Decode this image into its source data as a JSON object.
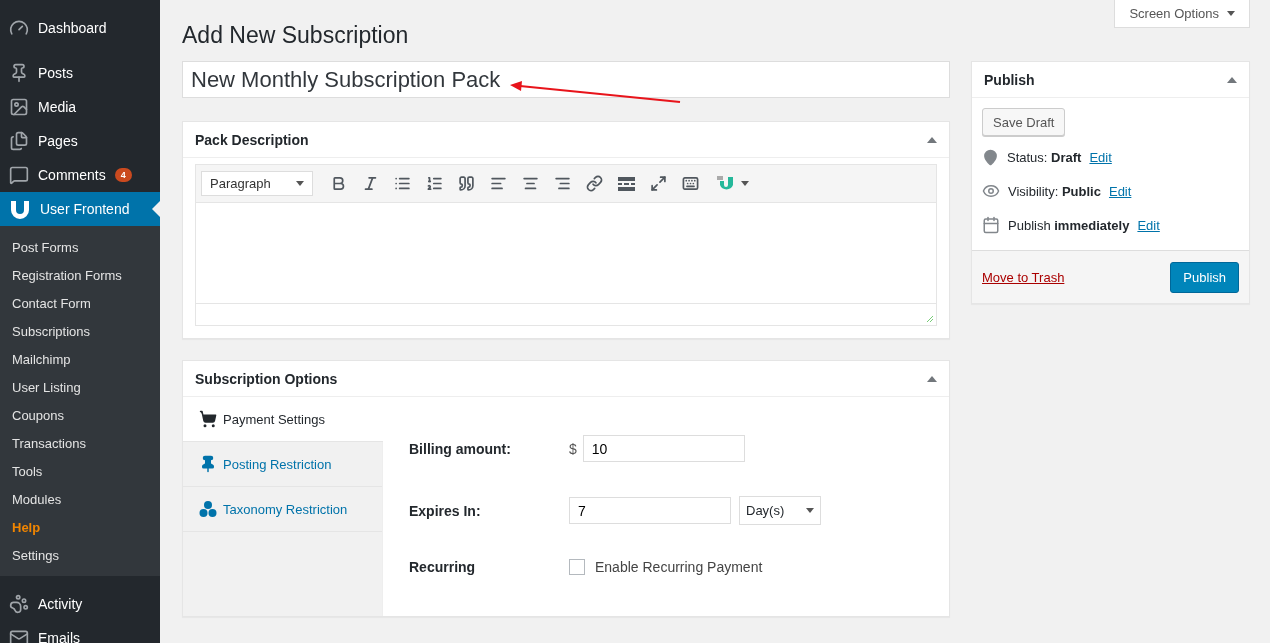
{
  "sidebar": {
    "top": [
      {
        "label": "Dashboard"
      }
    ],
    "menu": [
      {
        "label": "Posts",
        "selected": false
      },
      {
        "label": "Media",
        "selected": false
      },
      {
        "label": "Pages",
        "selected": false
      },
      {
        "label": "Comments",
        "badge": "4",
        "selected": false
      },
      {
        "label": "User Frontend",
        "selected": true
      }
    ],
    "submenu": [
      {
        "label": "Post Forms",
        "highlighted": false
      },
      {
        "label": "Registration Forms",
        "highlighted": false
      },
      {
        "label": "Contact Form",
        "highlighted": false
      },
      {
        "label": "Subscriptions",
        "highlighted": false
      },
      {
        "label": "Mailchimp",
        "highlighted": false
      },
      {
        "label": "User Listing",
        "highlighted": false
      },
      {
        "label": "Coupons",
        "highlighted": false
      },
      {
        "label": "Transactions",
        "highlighted": false
      },
      {
        "label": "Tools",
        "highlighted": false
      },
      {
        "label": "Modules",
        "highlighted": false
      },
      {
        "label": "Help",
        "highlighted": true
      },
      {
        "label": "Settings",
        "highlighted": false
      }
    ],
    "bottom": [
      {
        "label": "Activity"
      },
      {
        "label": "Emails"
      }
    ]
  },
  "screen_options": "Screen Options",
  "page_title": "Add New Subscription",
  "title_field": {
    "value": "New Monthly Subscription Pack"
  },
  "pack_description": {
    "title": "Pack Description",
    "format": "Paragraph"
  },
  "subscription_options": {
    "title": "Subscription Options",
    "tabs": [
      {
        "label": "Payment Settings",
        "selected": true
      },
      {
        "label": "Posting Restriction",
        "selected": false
      },
      {
        "label": "Taxonomy Restriction",
        "selected": false
      }
    ],
    "billing": {
      "label": "Billing amount:",
      "currency": "$",
      "value": "10"
    },
    "expires": {
      "label": "Expires In:",
      "value": "7",
      "unit": "Day(s)"
    },
    "recurring": {
      "label": "Recurring",
      "option": "Enable Recurring Payment",
      "checked": false
    }
  },
  "publish": {
    "title": "Publish",
    "save_draft": "Save Draft",
    "rows": [
      {
        "text": "Status: **Draft**",
        "link": "Edit"
      },
      {
        "text": "Visibility: **Public**",
        "link": "Edit"
      },
      {
        "text": "Publish **immediately**",
        "link": "Edit"
      }
    ],
    "trash": "Move to Trash",
    "button": "Publish"
  }
}
